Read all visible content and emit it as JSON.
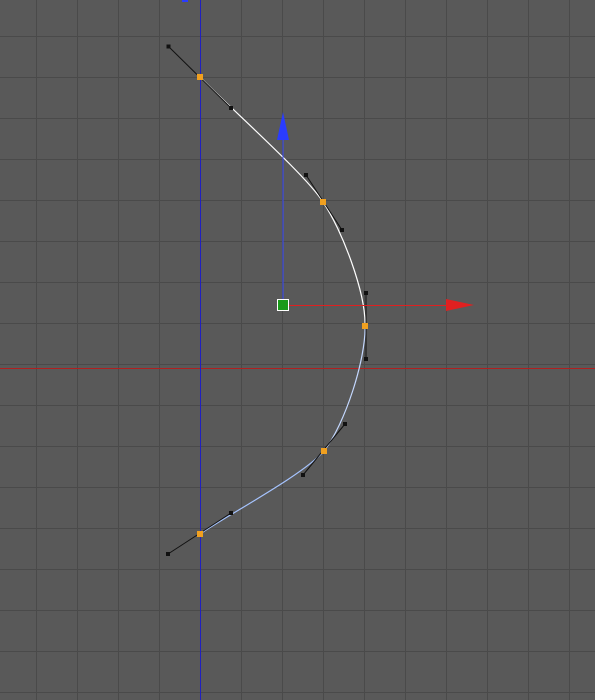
{
  "viewport": {
    "view": "editor-viewport",
    "background": "#595959",
    "grid_line_color": "#4a4a4a",
    "x_axis_color": "#b02020",
    "y_axis_color": "#2020c0"
  },
  "curve": {
    "type": "bezier-spline",
    "segment_count": 4,
    "point_count": 5,
    "stroke_color_top": "#ffffff",
    "stroke_color_bottom": "#a6c4ff",
    "control_point_color": "#f0a020",
    "tangent_handle_color": "#111111"
  },
  "gizmo": {
    "type": "move-gizmo",
    "x_arrow_color": "#e02020",
    "y_arrow_color": "#2a3cff",
    "center_color": "#1a9a1a"
  }
}
